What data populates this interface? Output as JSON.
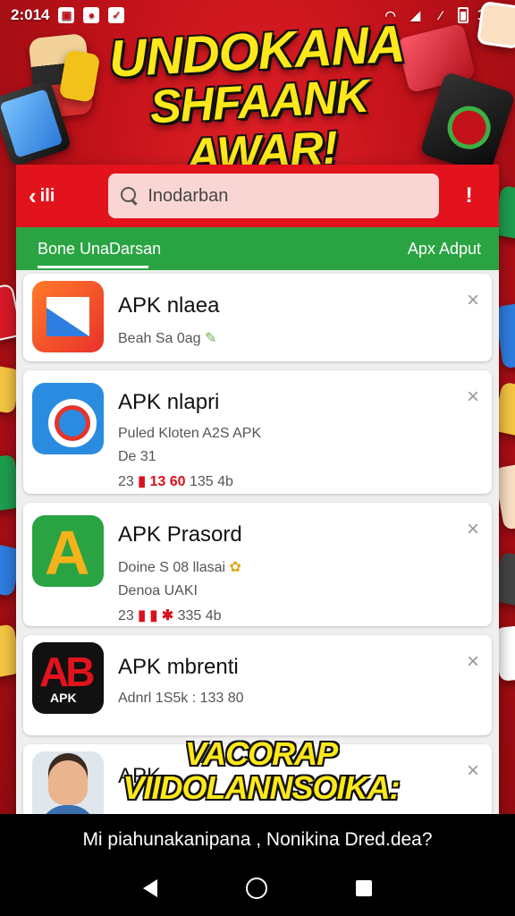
{
  "status_bar": {
    "time": "2:014",
    "battery_text": "100"
  },
  "headline": {
    "line1": "UNDOKANA",
    "line2": "SHFAANK AWAR!"
  },
  "app_bar": {
    "back_label": "ili",
    "search_text": "Inodarban",
    "alert_label": "!"
  },
  "tabs": {
    "left": "Bone UnaDarsan",
    "right": "Apx Adput"
  },
  "items": [
    {
      "title": "APK nlaea",
      "lines": [
        "Beah Sa 0ag"
      ]
    },
    {
      "title": "APK nlapri",
      "lines": [
        "Puled Kloten A2S APK",
        "De 31"
      ],
      "stats": {
        "pre": "23 ",
        "red": "13 60",
        "post": " 135 4b"
      }
    },
    {
      "title": "APK Prasord",
      "lines": [
        "Doine S 08 llasai",
        "Denoa UAKI"
      ],
      "stats": {
        "pre": "23 ",
        "red": "",
        "post": " 335 4b"
      }
    },
    {
      "title": "APK mbrenti",
      "lines": [
        "Adnrl 1S5k : 133 80"
      ]
    },
    {
      "title": "APK"
    }
  ],
  "overlay_caption": {
    "line1": "VACORAP",
    "line2": "VIIDOLANNSOIKA:"
  },
  "subtitle": "Mi piahunakanipana , Nonikina Dred.dea?",
  "colors": {
    "brand_red": "#e2131c",
    "tab_green": "#2aa443",
    "headline_yellow": "#ffe81a"
  }
}
